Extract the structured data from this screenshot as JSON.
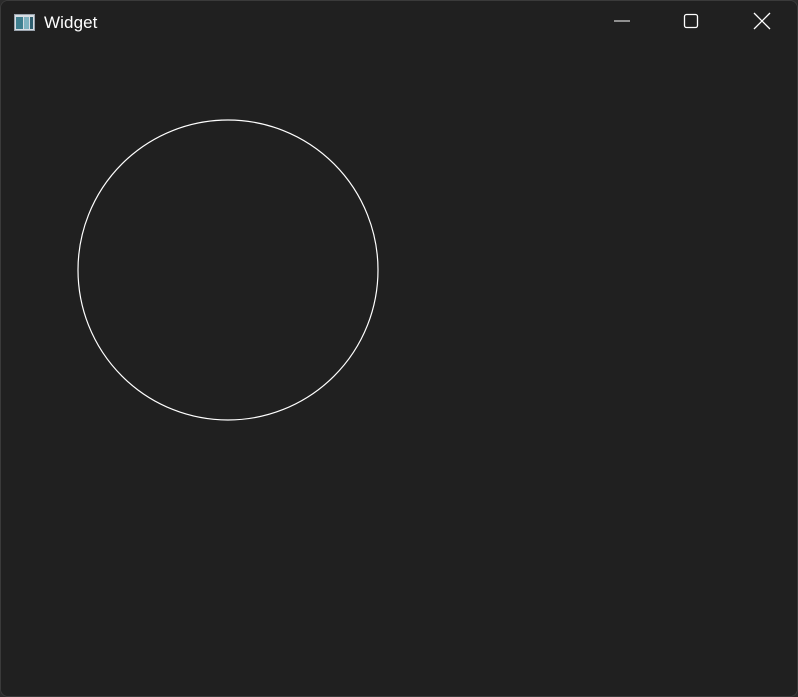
{
  "window": {
    "title": "Widget",
    "icon": "app-window-icon",
    "caption_buttons": [
      "minimize-icon",
      "maximize-icon",
      "close-icon"
    ]
  },
  "canvas": {
    "shapes": [
      {
        "type": "circle",
        "stroke": "#ffffff",
        "fill": "none"
      }
    ]
  },
  "colors": {
    "background": "#202020",
    "stroke": "#ffffff"
  }
}
